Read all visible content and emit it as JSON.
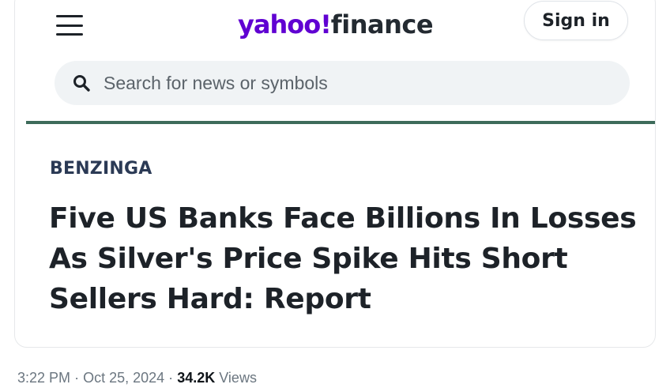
{
  "header": {
    "menu_icon": "hamburger-menu-icon",
    "logo": {
      "brand": "yahoo",
      "bang": "!",
      "product": "finance",
      "brand_color": "#6001d2"
    },
    "sign_in_label": "Sign in"
  },
  "search": {
    "icon": "search-icon",
    "placeholder": "Search for news or symbols",
    "value": ""
  },
  "article": {
    "source": "BENZINGA",
    "headline": "Five US Banks Face Billions In Losses As Silver's Price Spike Hits Short Sellers Hard: Report"
  },
  "post_meta": {
    "time": "3:22 PM",
    "sep1": "·",
    "date": "Oct 25, 2024",
    "sep2": "·",
    "views_count": "34.2K",
    "views_label": "Views"
  },
  "colors": {
    "divider": "#3d6b5a",
    "source_text": "#2b3a55",
    "headline_text": "#1d2228",
    "meta_text": "#6b7680"
  }
}
